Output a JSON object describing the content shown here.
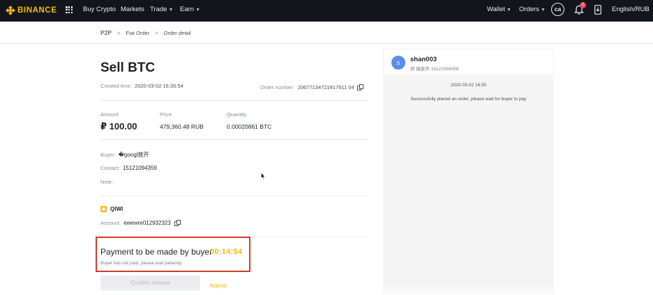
{
  "nav": {
    "logo": "BINANCE",
    "buy_crypto": "Buy Crypto",
    "markets": "Markets",
    "trade": "Trade",
    "earn": "Earn",
    "wallet": "Wallet",
    "orders": "Orders",
    "avatar": "ca",
    "notification_count": "2",
    "language": "English/RUB",
    "brand_color": "#f0b90b"
  },
  "breadcrumb": {
    "p2p": "P2P",
    "fiat_order": "Fiat Order",
    "order_detail": "Order detail"
  },
  "order": {
    "title": "Sell BTC",
    "created_label": "Created time:",
    "created_value": "2020-03-02 16:35:54",
    "order_number_label": "Order number:",
    "order_number_value": "20677134721917911 04",
    "amount_label": "Amount",
    "amount_value": "₽ 100.00",
    "price_label": "Price",
    "price_value": "479,360.48 RUB",
    "quantity_label": "Quantity",
    "quantity_value": "0.00020861 BTC",
    "buyer_label": "Buyer:",
    "buyer_value": "�googl放开",
    "contact_label": "Contact:",
    "contact_value": "15121094359",
    "note_label": "Note:",
    "payment_method": "QIWI",
    "account_label": "Account:",
    "account_value": "ewewre012932323"
  },
  "payment": {
    "title": "Payment to be made by buyer",
    "timer": "00:14:54",
    "subtitle": "Buyer has not paid, please wait patiently",
    "confirm_label": "Confirm release",
    "appeal_label": "Appeal",
    "highlight_color": "#d13a2b"
  },
  "chat": {
    "avatar_letter": "s",
    "name": "shan003",
    "subtitle": "捏 搞放开 15121094359",
    "timestamp": "2020-03-02 16:35",
    "message": "Successfully placed an order, please wait for buyer to pay"
  }
}
